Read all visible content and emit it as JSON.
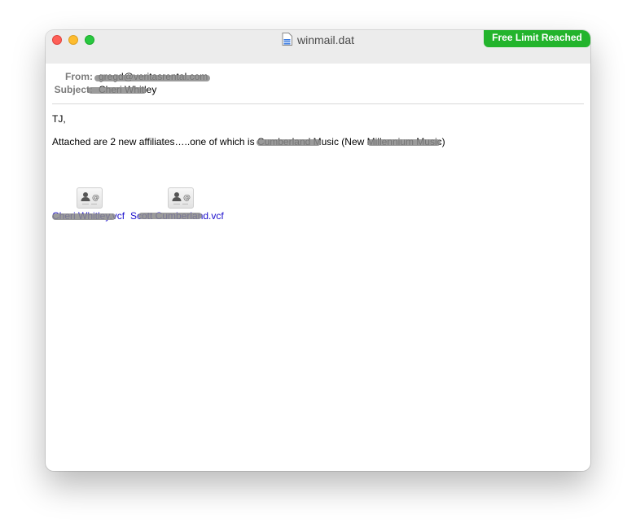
{
  "window": {
    "title": "winmail.dat",
    "badge": "Free Limit Reached"
  },
  "headers": {
    "from_label": "From:",
    "from_value": "gregd@veritasrental.com",
    "subject_label": "Subject:",
    "subject_value": "Cheri Whitley"
  },
  "message": {
    "greeting": "TJ,",
    "line1": "Attached are 2 new affiliates…..one of which is Cumberland Music (New Millennium Music)"
  },
  "attachments": [
    {
      "name": "Cheri Whitley.vcf",
      "icon": "vcard-icon"
    },
    {
      "name": "Scott Cumberland.vcf",
      "icon": "vcard-icon"
    }
  ],
  "colors": {
    "badge": "#23b42c",
    "link": "#1a0dcc",
    "titlebar": "#ececec"
  }
}
